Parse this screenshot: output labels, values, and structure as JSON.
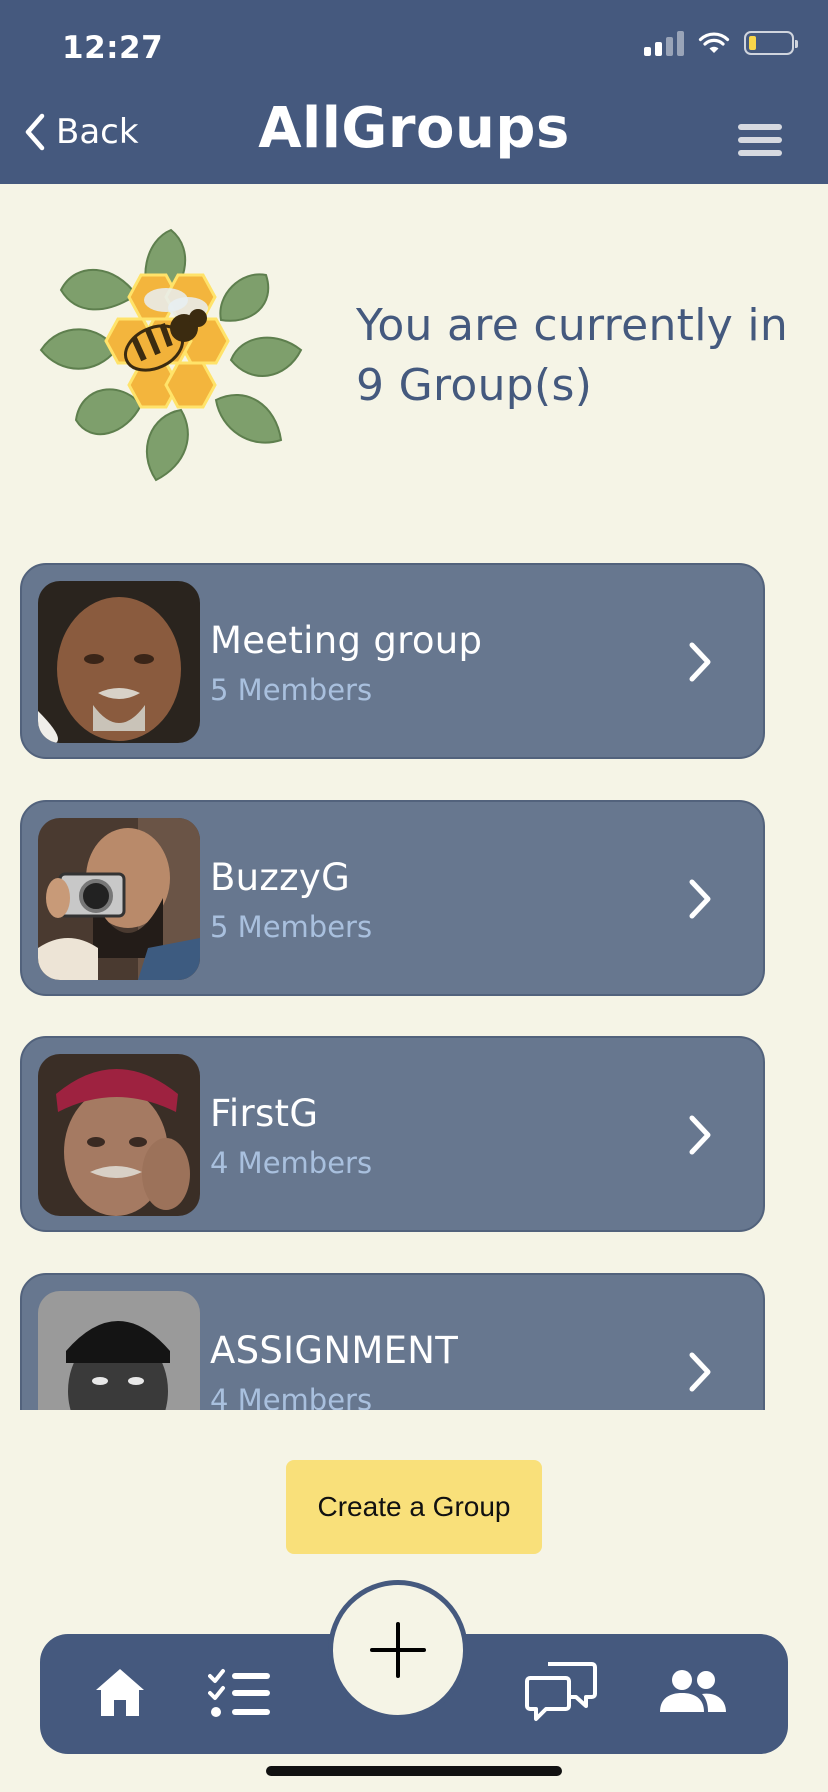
{
  "status_bar": {
    "time": "12:27"
  },
  "header": {
    "back_label": "Back",
    "title": "AllGroups"
  },
  "hero": {
    "text": "You are currently in 9 Group(s)"
  },
  "groups": [
    {
      "name": "Meeting group",
      "members": "5 Members"
    },
    {
      "name": "BuzzyG",
      "members": "5 Members"
    },
    {
      "name": "FirstG",
      "members": "4 Members"
    },
    {
      "name": "ASSIGNMENT",
      "members": "4 Members"
    }
  ],
  "create_button": {
    "label": "Create a Group"
  },
  "bottom_nav": {
    "items": [
      "home-icon",
      "task-list-icon",
      "add-icon",
      "chat-icon",
      "people-icon"
    ]
  },
  "colors": {
    "header": "#45597E",
    "background": "#F5F4E6",
    "card": "#67778F",
    "accent_yellow": "#F9E07A",
    "member_text": "#A9C0DE"
  }
}
